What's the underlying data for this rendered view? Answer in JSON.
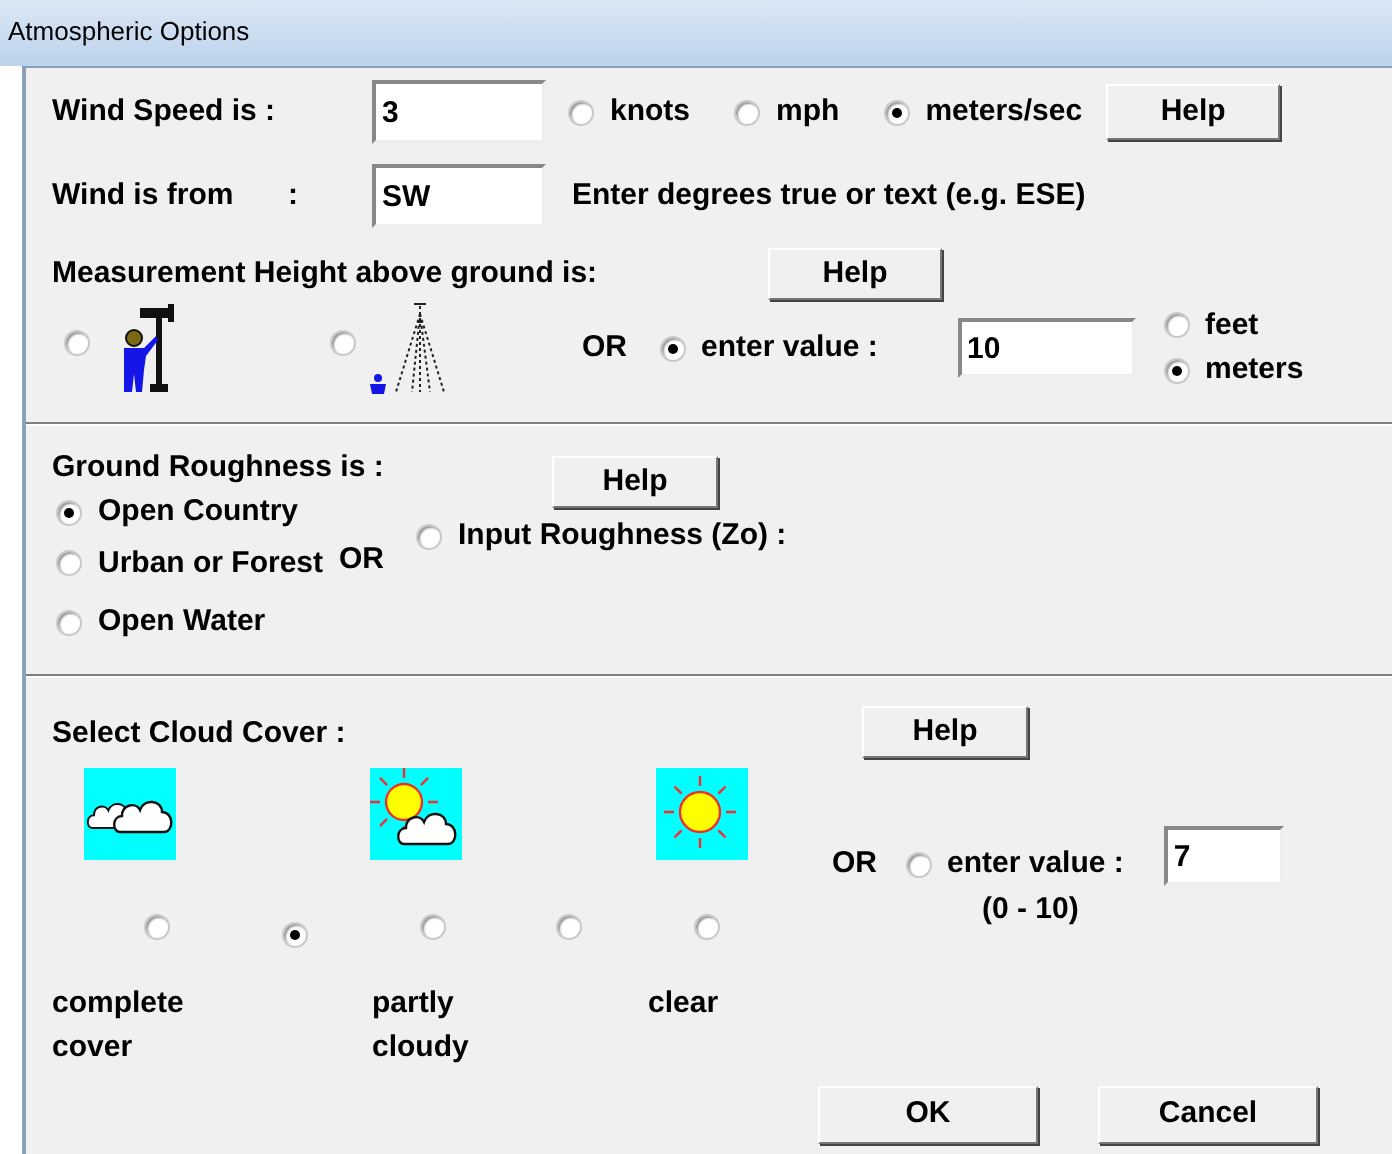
{
  "window": {
    "title": "Atmospheric Options"
  },
  "wind_speed": {
    "label": "Wind Speed is :",
    "value": "3",
    "help": "Help",
    "units": [
      {
        "label": "knots",
        "selected": false
      },
      {
        "label": "mph",
        "selected": false
      },
      {
        "label": "meters/sec",
        "selected": true
      }
    ]
  },
  "wind_direction": {
    "label": "Wind is from",
    "colon": ":",
    "value": "SW",
    "hint": "Enter degrees true or text (e.g. ESE)"
  },
  "measurement_height": {
    "label": "Measurement Height above ground is:",
    "help": "Help",
    "or": "OR",
    "options": [
      {
        "kind": "person",
        "selected": false
      },
      {
        "kind": "tower",
        "selected": false
      }
    ],
    "enter_value": {
      "label": "enter value :",
      "selected": true,
      "value": "10"
    },
    "units": [
      {
        "label": "feet",
        "selected": false
      },
      {
        "label": "meters",
        "selected": true
      }
    ]
  },
  "ground_roughness": {
    "label": "Ground Roughness is :",
    "help": "Help",
    "or": "OR",
    "options": [
      {
        "label": "Open Country",
        "selected": true
      },
      {
        "label": "Urban or Forest",
        "selected": false
      },
      {
        "label": "Open Water",
        "selected": false
      }
    ],
    "input_roughness": {
      "label": "Input Roughness (Zo) :",
      "selected": false
    }
  },
  "cloud_cover": {
    "label": "Select Cloud Cover :",
    "help": "Help",
    "or": "OR",
    "options": [
      {
        "label": "complete cover",
        "selected": false
      },
      {
        "selected": true
      },
      {
        "label": "partly cloudy",
        "selected": false
      },
      {
        "selected": false
      },
      {
        "label": "clear",
        "selected": false
      }
    ],
    "enter_value": {
      "label": "enter value :",
      "range": "(0 - 10)",
      "selected": false,
      "value": "7"
    }
  },
  "buttons": [
    {
      "label": "OK"
    },
    {
      "label": "Cancel"
    }
  ]
}
